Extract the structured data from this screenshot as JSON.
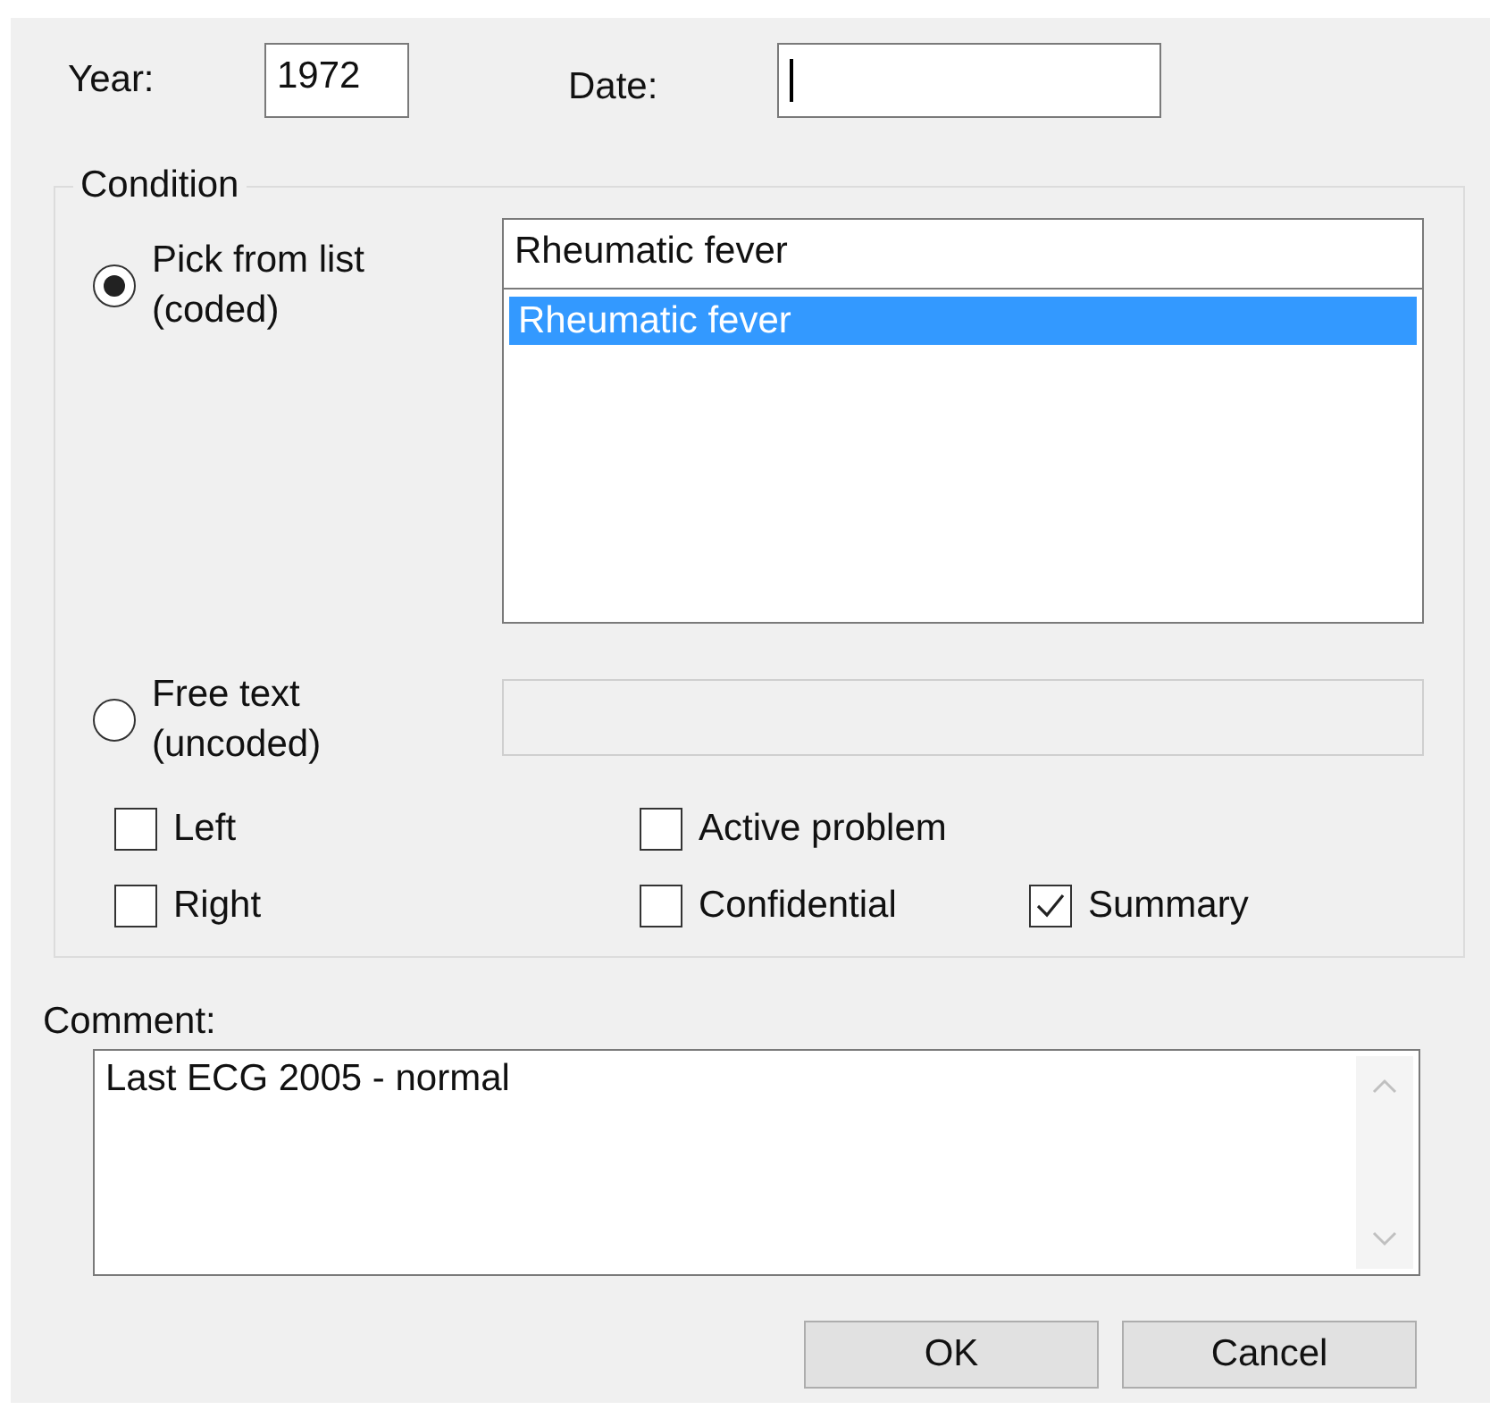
{
  "year": {
    "label": "Year:",
    "value": "1972"
  },
  "date": {
    "label": "Date:",
    "focused": true
  },
  "condition": {
    "legend": "Condition",
    "options": [
      {
        "label": "Pick from list\n(coded)",
        "selected": true,
        "kind": "list"
      },
      {
        "label": "Free text\n(uncoded)",
        "selected": false,
        "kind": "text"
      }
    ],
    "search_value": "Rheumatic fever",
    "list_items": [
      {
        "label": "Rheumatic fever",
        "selected": true
      }
    ],
    "free_text": {
      "disabled": true
    },
    "checkbox_rows": [
      [
        {
          "label": "Left",
          "checked": false
        },
        {
          "label": "Active problem",
          "checked": false
        }
      ],
      [
        {
          "label": "Right",
          "checked": false
        },
        {
          "label": "Confidential",
          "checked": false
        },
        {
          "label": "Summary",
          "checked": true
        }
      ]
    ]
  },
  "comment": {
    "label": "Comment:",
    "value": "Last ECG 2005 - normal"
  },
  "buttons": [
    "OK",
    "Cancel"
  ]
}
